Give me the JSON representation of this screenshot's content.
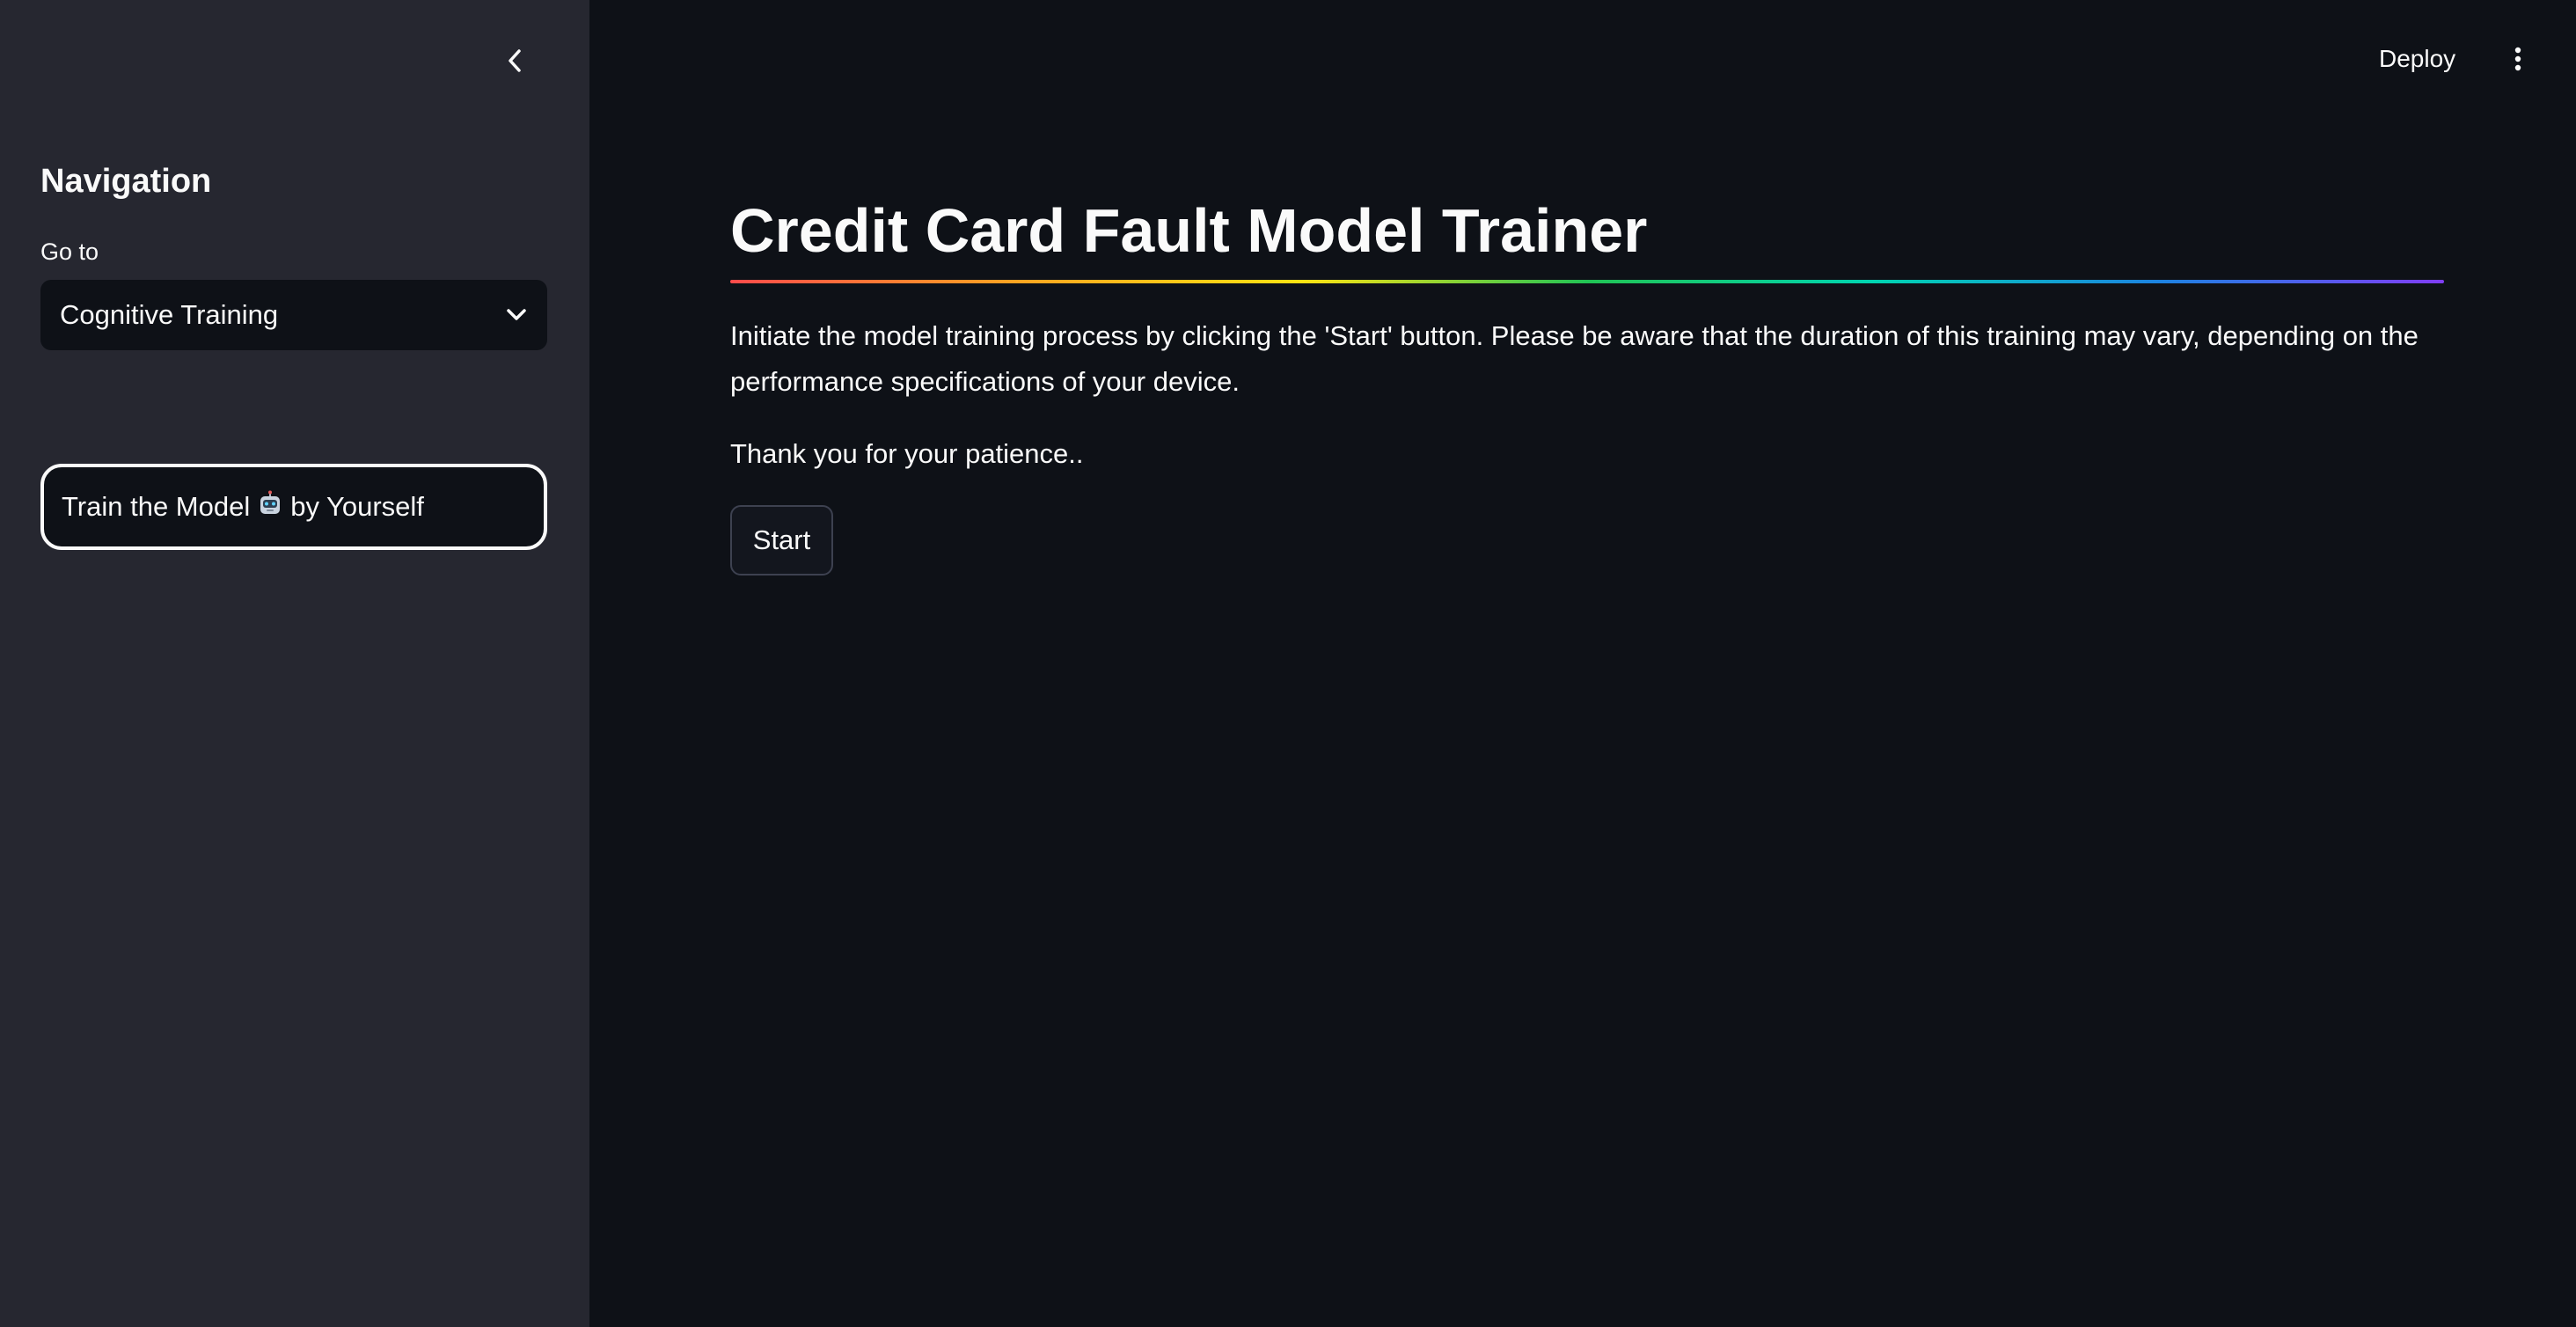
{
  "sidebar": {
    "title": "Navigation",
    "select_label": "Go to",
    "select_value": "Cognitive Training",
    "train_button": {
      "prefix": "Train the Model",
      "icon": "robot-icon",
      "suffix": "by Yourself"
    },
    "background": "#262730"
  },
  "header": {
    "deploy_label": "Deploy",
    "menu_icon": "vertical-dots-icon"
  },
  "main": {
    "title": "Credit Card Fault Model Trainer",
    "paragraph": "Initiate the model training process by clicking the 'Start' button. Please be aware that the duration of this training may vary, depending on the performance specifications of your device.",
    "thanks": "Thank you for your patience..",
    "start_label": "Start",
    "background": "#0e1117"
  }
}
